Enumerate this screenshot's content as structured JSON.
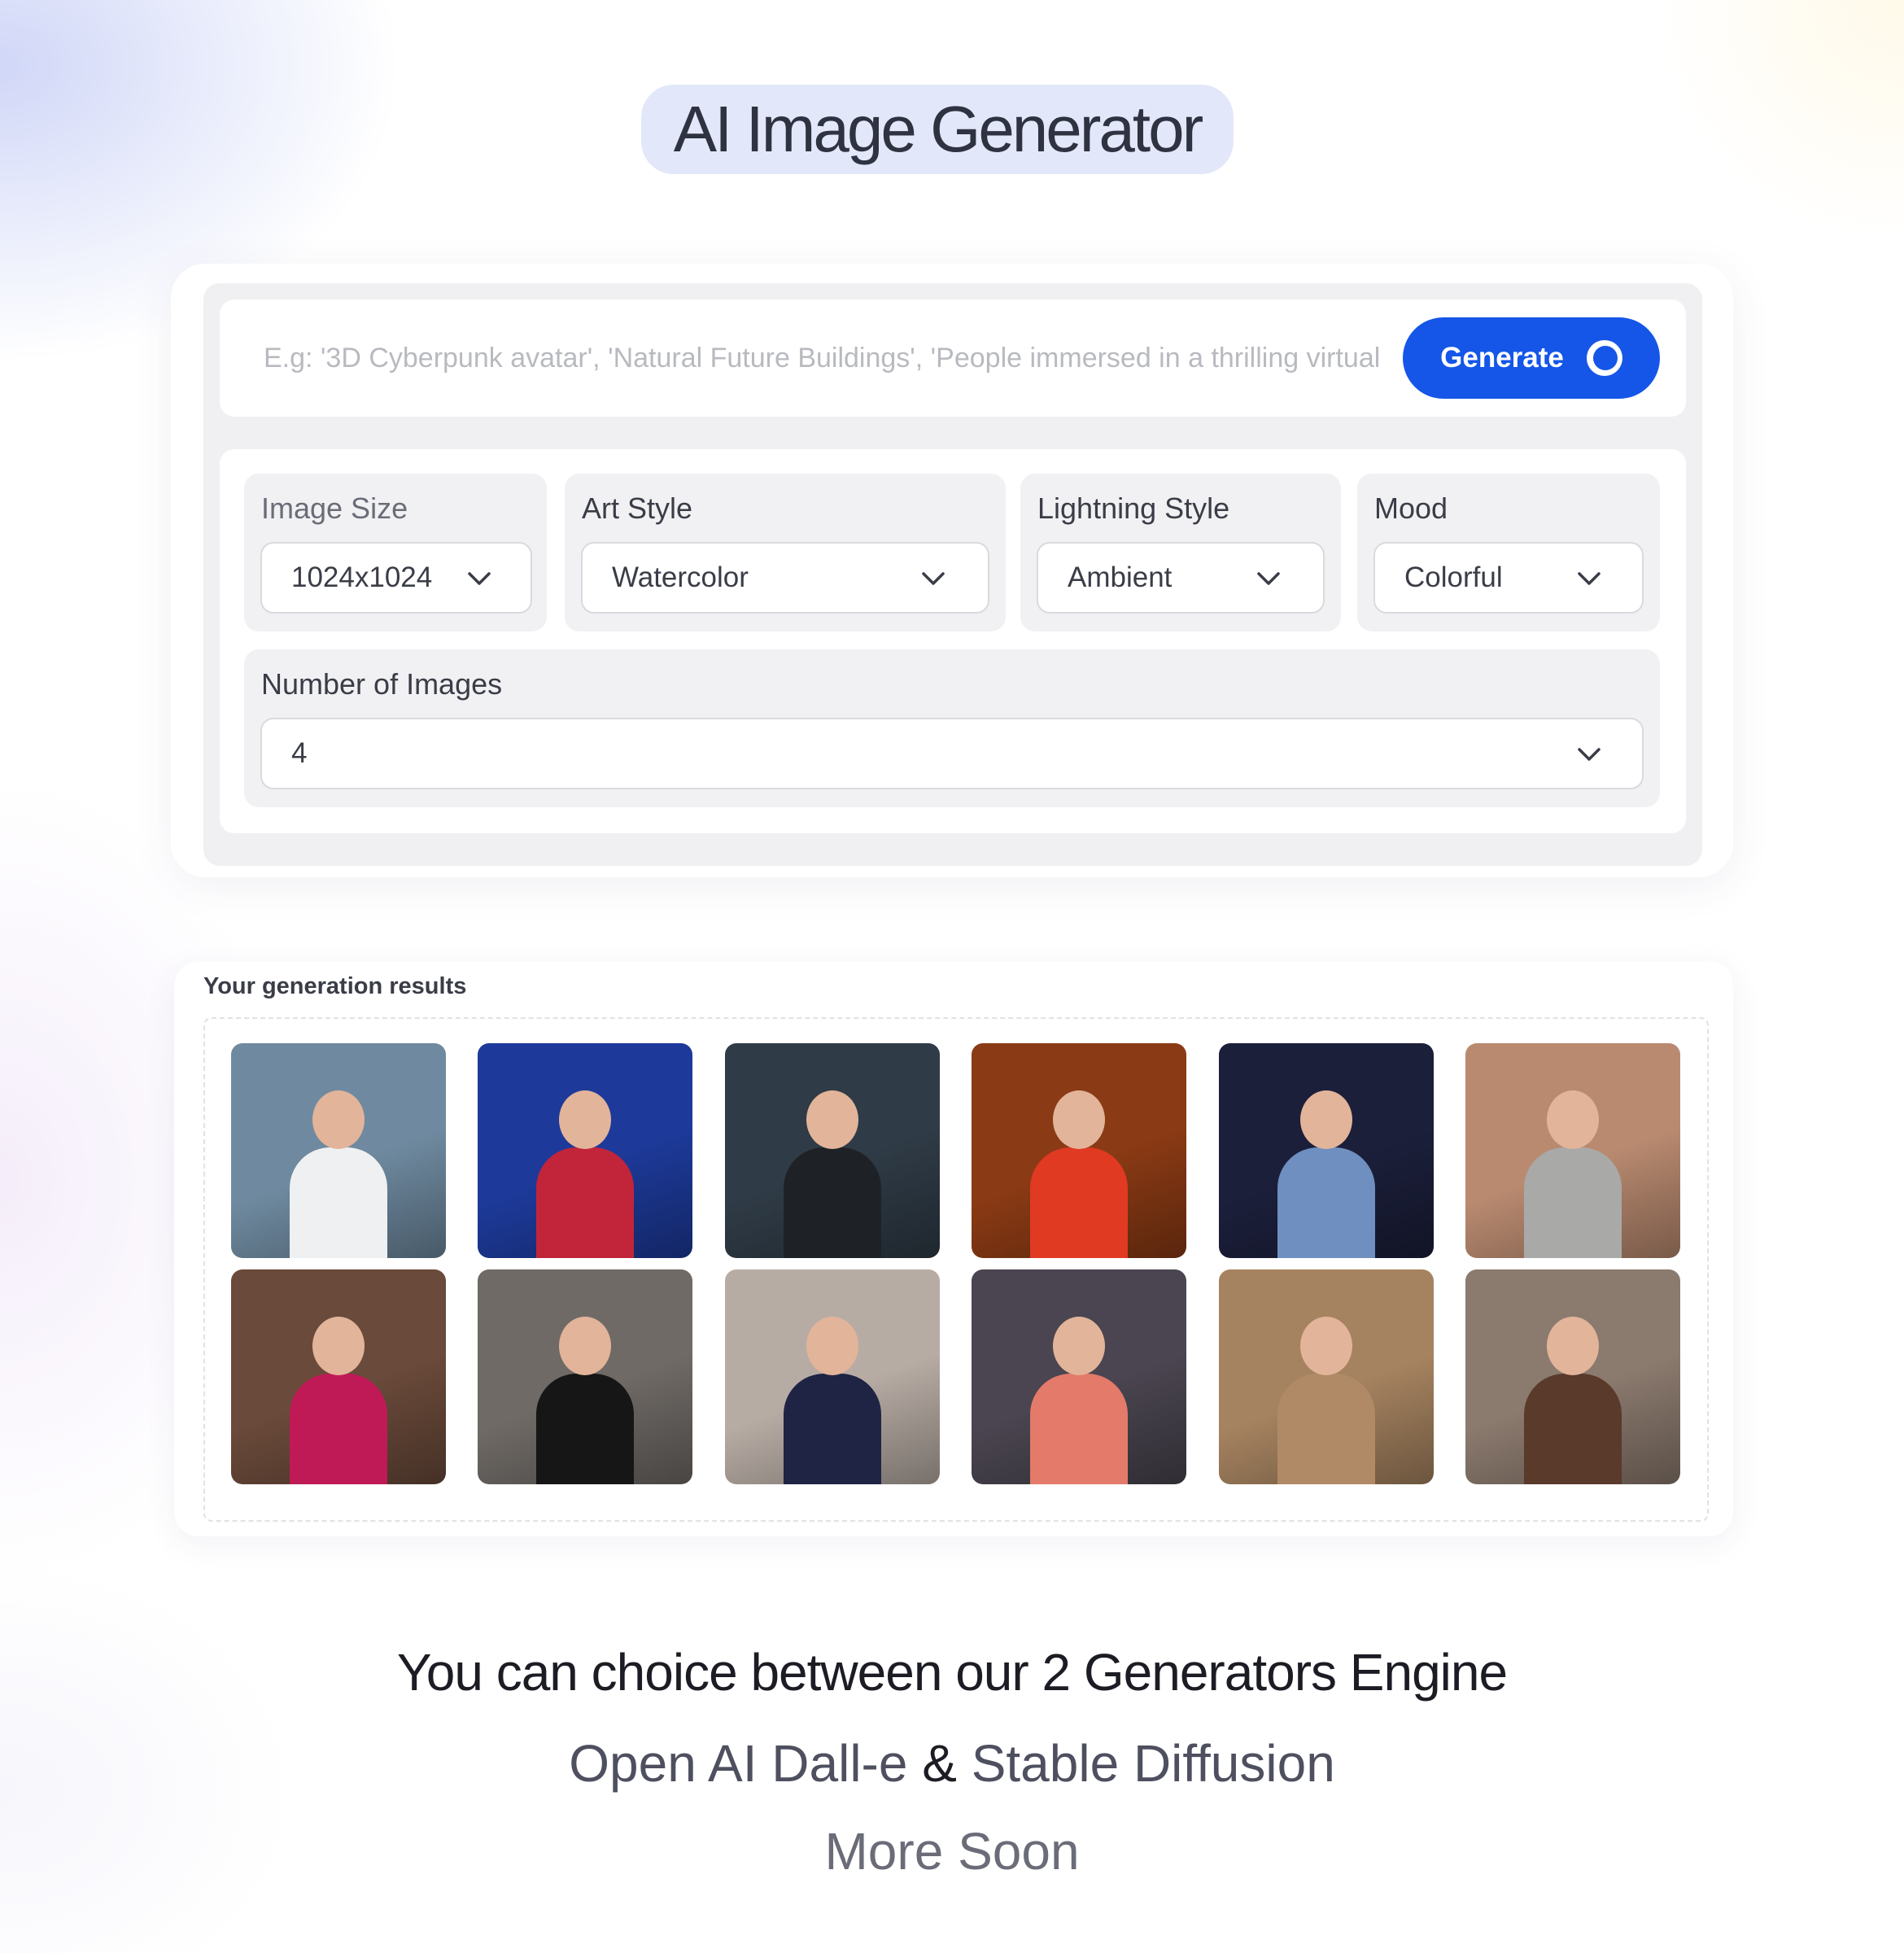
{
  "header": {
    "title": "AI Image Generator"
  },
  "prompt": {
    "placeholder": "E.g: '3D Cyberpunk avatar', 'Natural Future Buildings', 'People immersed in a thrilling virtual reality experience'",
    "generate_label": "Generate"
  },
  "options": {
    "image_size": {
      "label": "Image Size",
      "value": "1024x1024"
    },
    "art_style": {
      "label": "Art Style",
      "value": "Watercolor"
    },
    "lightning_style": {
      "label": "Lightning Style",
      "value": "Ambient"
    },
    "mood": {
      "label": "Mood",
      "value": "Colorful"
    },
    "number_of_images": {
      "label": "Number of Images",
      "value": "4"
    }
  },
  "results": {
    "title": "Your generation results",
    "images": [
      {
        "icon": "photo-man-white-shirt",
        "bg": "#6f8aa0",
        "accent": "#eef0f2"
      },
      {
        "icon": "photo-woman-red-plaid",
        "bg": "#1d3a9a",
        "accent": "#c2253a"
      },
      {
        "icon": "photo-woman-dark-chair",
        "bg": "#2f3b46",
        "accent": "#1e2226"
      },
      {
        "icon": "photo-woman-red-dress",
        "bg": "#8a3a14",
        "accent": "#e03a22"
      },
      {
        "icon": "photo-woman-jeans-neon",
        "bg": "#1b1f3a",
        "accent": "#6f8fc0"
      },
      {
        "icon": "photo-woman-number-props",
        "bg": "#b98a70",
        "accent": "#a9a9a8"
      },
      {
        "icon": "photo-woman-balloons",
        "bg": "#6a4a3a",
        "accent": "#c01a56"
      },
      {
        "icon": "photo-woman-black-blouse",
        "bg": "#6f6a66",
        "accent": "#161616"
      },
      {
        "icon": "photo-woman-white-chair",
        "bg": "#b7aca4",
        "accent": "#1f2444"
      },
      {
        "icon": "photo-woman-pink-dress",
        "bg": "#4a4550",
        "accent": "#e47a6a"
      },
      {
        "icon": "photo-woman-champagne",
        "bg": "#a68360",
        "accent": "#b08a66"
      },
      {
        "icon": "photo-two-women-clock",
        "bg": "#8b7a6e",
        "accent": "#5a3a2a"
      }
    ]
  },
  "footer": {
    "line1": "You can choice between our 2 Generators Engine",
    "engine1": "Open AI Dall-e",
    "amp": "&",
    "engine2": "Stable Diffusion",
    "line3": "More Soon"
  },
  "colors": {
    "primary": "#1556e8",
    "title_pill_bg": "#e3e7fa",
    "panel_bg": "#f0f0f2"
  }
}
